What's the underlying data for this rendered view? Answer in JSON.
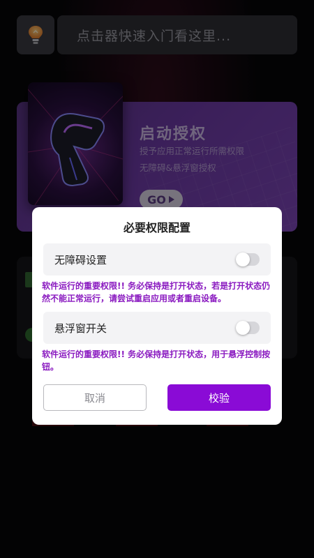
{
  "header": {
    "search_placeholder": "点击器快速入门看这里..."
  },
  "banner": {
    "title": "启动授权",
    "desc_line1": "授予应用正常运行所需权限",
    "desc_line2": "无障碍&悬浮窗授权",
    "go_label": "GO"
  },
  "dialog": {
    "title": "必要权限配置",
    "permissions": [
      {
        "label": "无障碍设置",
        "enabled": false,
        "note": "软件运行的重要权限!! 务必保持是打开状态，若是打开状态仍然不能正常运行，请尝试重启应用或者重启设备。"
      },
      {
        "label": "悬浮窗开关",
        "enabled": false,
        "note": "软件运行的重要权限!! 务必保持是打开状态，用于悬浮控制按钮。"
      }
    ],
    "cancel_label": "取消",
    "verify_label": "校验"
  },
  "colors": {
    "accent_purple": "#8a0bd6",
    "note_text": "#8a1ac0",
    "banner_purple": "#6c3aa4"
  },
  "icons": {
    "tip": "lightbulb-icon",
    "go_arrow": "play-arrow-icon"
  }
}
